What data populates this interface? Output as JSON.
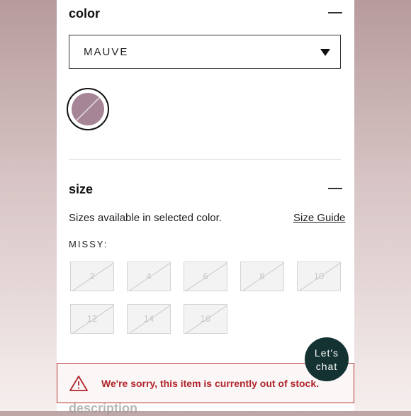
{
  "color_section": {
    "title": "color",
    "selected_color": "MAUVE",
    "swatch_color": "#a68596"
  },
  "size_section": {
    "title": "size",
    "availability_text": "Sizes available in selected color.",
    "size_guide_link": "Size Guide",
    "group_label": "MISSY:",
    "sizes": [
      "2",
      "4",
      "6",
      "8",
      "10",
      "12",
      "14",
      "16"
    ]
  },
  "chat": {
    "line1": "Let's",
    "line2": "chat"
  },
  "banner": {
    "message": "We're sorry, this item is currently out of stock."
  },
  "next_section": {
    "title": "description"
  },
  "colors": {
    "error": "#b1242b",
    "chat_bg": "#153232"
  }
}
